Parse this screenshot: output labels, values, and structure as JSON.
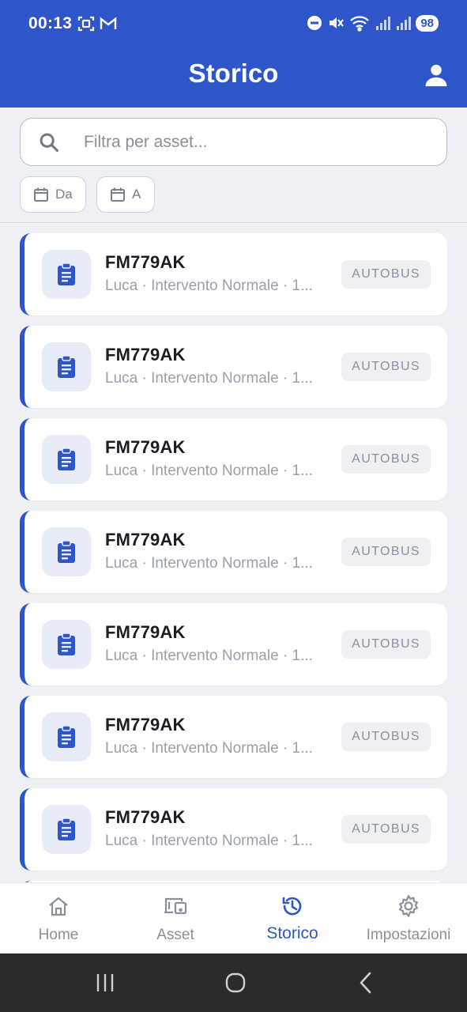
{
  "status_bar": {
    "time": "00:13",
    "battery": "98",
    "left_icons": [
      "screenshot-icon",
      "gmail-icon"
    ],
    "right_icons": [
      "dnd-icon",
      "mute-icon",
      "wifi-icon",
      "signal-icon",
      "signal-icon"
    ]
  },
  "header": {
    "title": "Storico",
    "profile_icon": "person-icon"
  },
  "search": {
    "placeholder": "Filtra per asset...",
    "value": ""
  },
  "date_filters": {
    "from_label": "Da",
    "to_label": "A"
  },
  "records": [
    {
      "plate": "FM779AK",
      "details": "Luca · Intervento Normale · 1...",
      "category": "AUTOBUS"
    },
    {
      "plate": "FM779AK",
      "details": "Luca · Intervento Normale · 1...",
      "category": "AUTOBUS"
    },
    {
      "plate": "FM779AK",
      "details": "Luca · Intervento Normale · 1...",
      "category": "AUTOBUS"
    },
    {
      "plate": "FM779AK",
      "details": "Luca · Intervento Normale · 1...",
      "category": "AUTOBUS"
    },
    {
      "plate": "FM779AK",
      "details": "Luca · Intervento Normale · 1...",
      "category": "AUTOBUS"
    },
    {
      "plate": "FM779AK",
      "details": "Luca · Intervento Normale · 1...",
      "category": "AUTOBUS"
    },
    {
      "plate": "FM779AK",
      "details": "Luca · Intervento Normale · 1...",
      "category": "AUTOBUS"
    }
  ],
  "bottom_nav": {
    "home": "Home",
    "asset": "Asset",
    "storico": "Storico",
    "impostazioni": "Impostazioni",
    "active": "storico"
  },
  "colors": {
    "primary": "#2f56c8",
    "background": "#eef0f5",
    "muted_text": "#9aa0ab"
  }
}
